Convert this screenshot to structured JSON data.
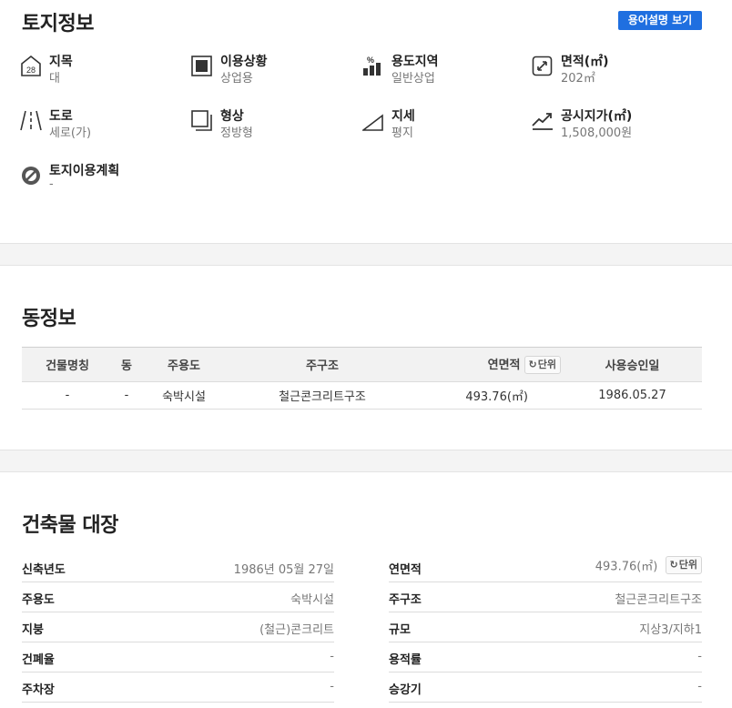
{
  "land": {
    "title": "토지정보",
    "term_button": "용어설명 보기",
    "items": [
      {
        "label": "지목",
        "value": "대",
        "icon": "lot-28-icon",
        "icon_text": "28"
      },
      {
        "label": "이용상황",
        "value": "상업용",
        "icon": "building-usage-icon"
      },
      {
        "label": "용도지역",
        "value": "일반상업",
        "icon": "percent-bar-icon",
        "icon_text": "%"
      },
      {
        "label": "면적(㎡)",
        "value": "202㎡",
        "icon": "area-expand-icon"
      },
      {
        "label": "도로",
        "value": "세로(가)",
        "icon": "road-icon"
      },
      {
        "label": "형상",
        "value": "정방형",
        "icon": "shape-square-icon"
      },
      {
        "label": "지세",
        "value": "평지",
        "icon": "slope-icon"
      },
      {
        "label": "공시지가(㎡)",
        "value": "1,508,000원",
        "icon": "price-trend-icon"
      },
      {
        "label": "토지이용계획",
        "value": "-",
        "icon": "no-plan-icon"
      }
    ]
  },
  "dong": {
    "title": "동정보",
    "columns": [
      "건물명칭",
      "동",
      "주용도",
      "주구조",
      "연면적",
      "사용승인일"
    ],
    "unit_button": "단위",
    "rows": [
      [
        "-",
        "-",
        "숙박시설",
        "철근콘크리트구조",
        "493.76(㎡)",
        "1986.05.27"
      ]
    ]
  },
  "register": {
    "title": "건축물 대장",
    "unit_button": "단위",
    "left": [
      {
        "key": "신축년도",
        "value": "1986년 05월 27일"
      },
      {
        "key": "주용도",
        "value": "숙박시설"
      },
      {
        "key": "지붕",
        "value": "(철근)콘크리트"
      },
      {
        "key": "건폐율",
        "value": "-"
      },
      {
        "key": "주차장",
        "value": "-"
      }
    ],
    "right": [
      {
        "key": "연면적",
        "value": "493.76(㎡)"
      },
      {
        "key": "주구조",
        "value": "철근콘크리트구조"
      },
      {
        "key": "규모",
        "value": "지상3/지하1"
      },
      {
        "key": "용적률",
        "value": "-"
      },
      {
        "key": "승강기",
        "value": "-"
      }
    ]
  },
  "colors": {
    "accent": "#1f6fe0",
    "gap": "#f4f4f4",
    "label": "#222222",
    "value": "#777777"
  }
}
